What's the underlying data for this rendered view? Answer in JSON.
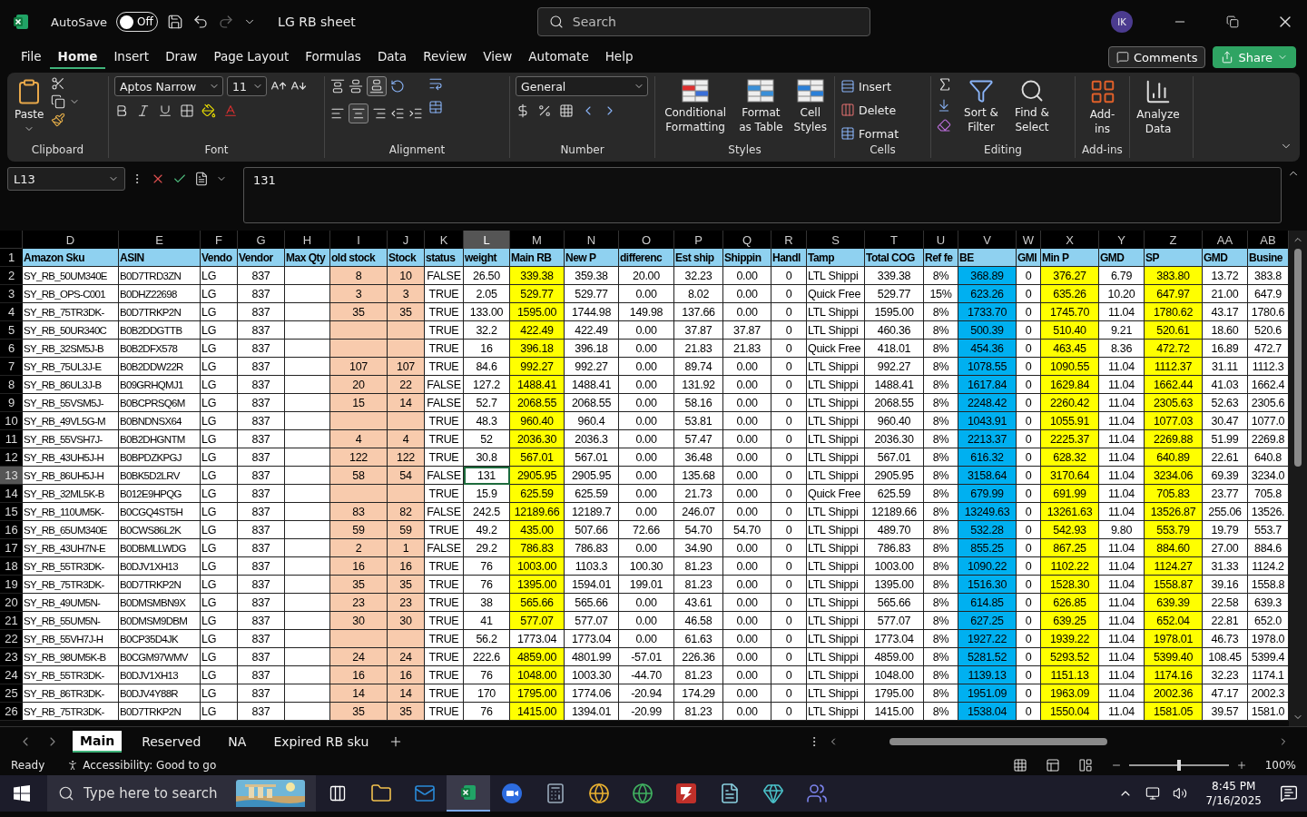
{
  "title_bar": {
    "autosave_label": "AutoSave",
    "autosave": {
      "on": false,
      "label": "Off"
    },
    "document_title": "LG RB sheet",
    "search": {
      "placeholder": "Search"
    },
    "avatar": "IK"
  },
  "menu_tabs": [
    {
      "label": "File",
      "selected": false
    },
    {
      "label": "Home",
      "selected": true
    },
    {
      "label": "Insert",
      "selected": false
    },
    {
      "label": "Draw",
      "selected": false
    },
    {
      "label": "Page Layout",
      "selected": false
    },
    {
      "label": "Formulas",
      "selected": false
    },
    {
      "label": "Data",
      "selected": false
    },
    {
      "label": "Review",
      "selected": false
    },
    {
      "label": "View",
      "selected": false
    },
    {
      "label": "Automate",
      "selected": false
    },
    {
      "label": "Help",
      "selected": false
    }
  ],
  "header_buttons": {
    "comments": "Comments",
    "share": "Share"
  },
  "ribbon": {
    "font_name": "Aptos Narrow",
    "font_size": "11",
    "number_format": "General",
    "groups": [
      {
        "label": "Clipboard",
        "buttons": [
          "Paste"
        ]
      },
      {
        "label": "Font"
      },
      {
        "label": "Alignment"
      },
      {
        "label": "Number"
      },
      {
        "label": "Styles",
        "buttons": [
          "Conditional Formatting",
          "Format as Table",
          "Cell Styles"
        ]
      },
      {
        "label": "Cells",
        "buttons": [
          "Insert",
          "Delete",
          "Format"
        ]
      },
      {
        "label": "Editing",
        "buttons": [
          "Sort & Filter",
          "Find & Select"
        ]
      },
      {
        "label": "Add-ins",
        "buttons": [
          "Add-ins"
        ]
      },
      {
        "buttons": [
          "Analyze Data"
        ]
      }
    ]
  },
  "formula_bar": {
    "name_box": "L13",
    "formula": "131"
  },
  "columns": [
    {
      "letter": "D",
      "header": "Amazon Sku",
      "selected": false
    },
    {
      "letter": "E",
      "header": "ASIN",
      "selected": false
    },
    {
      "letter": "F",
      "header": "Vendo",
      "selected": false
    },
    {
      "letter": "G",
      "header": "Vendor",
      "selected": false
    },
    {
      "letter": "H",
      "header": "Max Qty",
      "selected": false
    },
    {
      "letter": "I",
      "header": "old stock",
      "selected": false,
      "color": "#f8cbad"
    },
    {
      "letter": "J",
      "header": "Stock",
      "selected": false,
      "color": "#f8cbad"
    },
    {
      "letter": "K",
      "header": "status",
      "selected": false
    },
    {
      "letter": "L",
      "header": "weight",
      "selected": true
    },
    {
      "letter": "M",
      "header": "Main RB",
      "selected": false,
      "color": "#ffff00"
    },
    {
      "letter": "N",
      "header": "New P",
      "selected": false
    },
    {
      "letter": "O",
      "header": "differenc",
      "selected": false
    },
    {
      "letter": "P",
      "header": "Est ship",
      "selected": false
    },
    {
      "letter": "Q",
      "header": "Shippin",
      "selected": false
    },
    {
      "letter": "R",
      "header": "Handl",
      "selected": false
    },
    {
      "letter": "S",
      "header": "Tamp",
      "selected": false
    },
    {
      "letter": "T",
      "header": "Total COG",
      "selected": false
    },
    {
      "letter": "U",
      "header": "Ref fe",
      "selected": false
    },
    {
      "letter": "V",
      "header": "BE",
      "selected": false,
      "color": "#00b0f0"
    },
    {
      "letter": "W",
      "header": "GMI",
      "selected": false
    },
    {
      "letter": "X",
      "header": "Min P",
      "selected": false,
      "color": "#ffff00"
    },
    {
      "letter": "Y",
      "header": "GMD",
      "selected": false
    },
    {
      "letter": "Z",
      "header": "SP",
      "selected": false,
      "color": "#ffff00"
    },
    {
      "letter": "AA",
      "header": "GMD",
      "selected": false
    },
    {
      "letter": "AB",
      "header": "Busine",
      "selected": false
    }
  ],
  "header_row_number": "1",
  "rows": [
    {
      "number": "2",
      "selected": false,
      "highlighted": true,
      "cells": [
        "SY_RB_50UM340E",
        "B0D7TRD3ZN",
        "LG",
        "837",
        "",
        "8",
        "10",
        "FALSE",
        "26.50",
        "339.38",
        "359.38",
        "20.00",
        "32.23",
        "0.00",
        "0",
        "LTL Shippi",
        "339.38",
        "8%",
        "368.89",
        "0",
        "376.27",
        "6.79",
        "383.80",
        "13.72",
        "383.8"
      ]
    },
    {
      "number": "3",
      "selected": false,
      "highlighted": true,
      "cells": [
        "SY_RB_OPS-C001",
        "B0DHZ22698",
        "LG",
        "837",
        "",
        "3",
        "3",
        "TRUE",
        "2.05",
        "529.77",
        "529.77",
        "0.00",
        "8.02",
        "0.00",
        "0",
        "Quick Free",
        "529.77",
        "15%",
        "623.26",
        "0",
        "635.26",
        "10.20",
        "647.97",
        "21.00",
        "647.9"
      ]
    },
    {
      "number": "4",
      "selected": false,
      "highlighted": true,
      "cells": [
        "SY_RB_75TR3DK-",
        "B0D7TRKP2N",
        "LG",
        "837",
        "",
        "35",
        "35",
        "TRUE",
        "133.00",
        "1595.00",
        "1744.98",
        "149.98",
        "137.66",
        "0.00",
        "0",
        "LTL Shippi",
        "1595.00",
        "8%",
        "1733.70",
        "0",
        "1745.70",
        "11.04",
        "1780.62",
        "43.17",
        "1780.6"
      ]
    },
    {
      "number": "5",
      "selected": false,
      "highlighted": true,
      "cells": [
        "SY_RB_50UR340C",
        "B0B2DDGTTB",
        "LG",
        "837",
        "",
        "",
        "",
        "TRUE",
        "32.2",
        "422.49",
        "422.49",
        "0.00",
        "37.87",
        "37.87",
        "0",
        "LTL Shippi",
        "460.36",
        "8%",
        "500.39",
        "0",
        "510.40",
        "9.21",
        "520.61",
        "18.60",
        "520.6"
      ]
    },
    {
      "number": "6",
      "selected": false,
      "highlighted": true,
      "cells": [
        "SY_RB_32SM5J-B",
        "B0B2DFX578",
        "LG",
        "837",
        "",
        "",
        "",
        "TRUE",
        "16",
        "396.18",
        "396.18",
        "0.00",
        "21.83",
        "21.83",
        "0",
        "Quick Free",
        "418.01",
        "8%",
        "454.36",
        "0",
        "463.45",
        "8.36",
        "472.72",
        "16.89",
        "472.7"
      ]
    },
    {
      "number": "7",
      "selected": false,
      "highlighted": true,
      "cells": [
        "SY_RB_75UL3J-E",
        "B0B2DDW22R",
        "LG",
        "837",
        "",
        "107",
        "107",
        "TRUE",
        "84.6",
        "992.27",
        "992.27",
        "0.00",
        "89.74",
        "0.00",
        "0",
        "LTL Shippi",
        "992.27",
        "8%",
        "1078.55",
        "0",
        "1090.55",
        "11.04",
        "1112.37",
        "31.11",
        "1112.3"
      ]
    },
    {
      "number": "8",
      "selected": false,
      "highlighted": true,
      "cells": [
        "SY_RB_86UL3J-B",
        "B09GRHQMJ1",
        "LG",
        "837",
        "",
        "20",
        "22",
        "FALSE",
        "127.2",
        "1488.41",
        "1488.41",
        "0.00",
        "131.92",
        "0.00",
        "0",
        "LTL Shippi",
        "1488.41",
        "8%",
        "1617.84",
        "0",
        "1629.84",
        "11.04",
        "1662.44",
        "41.03",
        "1662.4"
      ]
    },
    {
      "number": "9",
      "selected": false,
      "highlighted": true,
      "cells": [
        "SY_RB_55VSM5J-",
        "B0BCPRSQ6M",
        "LG",
        "837",
        "",
        "15",
        "14",
        "FALSE",
        "52.7",
        "2068.55",
        "2068.55",
        "0.00",
        "58.16",
        "0.00",
        "0",
        "LTL Shippi",
        "2068.55",
        "8%",
        "2248.42",
        "0",
        "2260.42",
        "11.04",
        "2305.63",
        "52.63",
        "2305.6"
      ]
    },
    {
      "number": "10",
      "selected": false,
      "highlighted": true,
      "cells": [
        "SY_RB_49VL5G-M",
        "B0BNDNSX64",
        "LG",
        "837",
        "",
        "",
        "",
        "TRUE",
        "48.3",
        "960.40",
        "960.4",
        "0.00",
        "53.81",
        "0.00",
        "0",
        "LTL Shippi",
        "960.40",
        "8%",
        "1043.91",
        "0",
        "1055.91",
        "11.04",
        "1077.03",
        "30.47",
        "1077.0"
      ]
    },
    {
      "number": "11",
      "selected": false,
      "highlighted": true,
      "cells": [
        "SY_RB_55VSH7J-",
        "B0B2DHGNTM",
        "LG",
        "837",
        "",
        "4",
        "4",
        "TRUE",
        "52",
        "2036.30",
        "2036.3",
        "0.00",
        "57.47",
        "0.00",
        "0",
        "LTL Shippi",
        "2036.30",
        "8%",
        "2213.37",
        "0",
        "2225.37",
        "11.04",
        "2269.88",
        "51.99",
        "2269.8"
      ]
    },
    {
      "number": "12",
      "selected": false,
      "highlighted": true,
      "cells": [
        "SY_RB_43UH5J-H",
        "B0BPDZKPGJ",
        "LG",
        "837",
        "",
        "122",
        "122",
        "TRUE",
        "30.8",
        "567.01",
        "567.01",
        "0.00",
        "36.48",
        "0.00",
        "0",
        "LTL Shippi",
        "567.01",
        "8%",
        "616.32",
        "0",
        "628.32",
        "11.04",
        "640.89",
        "22.61",
        "640.8"
      ]
    },
    {
      "number": "13",
      "selected": true,
      "highlighted": true,
      "cells": [
        "SY_RB_86UH5J-H",
        "B0BK5D2LRV",
        "LG",
        "837",
        "",
        "58",
        "54",
        "FALSE",
        "131",
        "2905.95",
        "2905.95",
        "0.00",
        "135.68",
        "0.00",
        "0",
        "LTL Shippi",
        "2905.95",
        "8%",
        "3158.64",
        "0",
        "3170.64",
        "11.04",
        "3234.06",
        "69.39",
        "3234.0"
      ]
    },
    {
      "number": "14",
      "selected": false,
      "highlighted": true,
      "cells": [
        "SY_RB_32ML5K-B",
        "B012E9HPQG",
        "LG",
        "837",
        "",
        "",
        "",
        "TRUE",
        "15.9",
        "625.59",
        "625.59",
        "0.00",
        "21.73",
        "0.00",
        "0",
        "Quick Free",
        "625.59",
        "8%",
        "679.99",
        "0",
        "691.99",
        "11.04",
        "705.83",
        "23.77",
        "705.8"
      ]
    },
    {
      "number": "15",
      "selected": false,
      "highlighted": true,
      "cells": [
        "SY_RB_110UM5K-",
        "B0CGQ4ST5H",
        "LG",
        "837",
        "",
        "83",
        "82",
        "FALSE",
        "242.5",
        "12189.66",
        "12189.7",
        "0.00",
        "246.07",
        "0.00",
        "0",
        "LTL Shippi",
        "12189.66",
        "8%",
        "13249.63",
        "0",
        "13261.63",
        "11.04",
        "13526.87",
        "255.06",
        "13526."
      ]
    },
    {
      "number": "16",
      "selected": false,
      "highlighted": true,
      "cells": [
        "SY_RB_65UM340E",
        "B0CWS86L2K",
        "LG",
        "837",
        "",
        "59",
        "59",
        "TRUE",
        "49.2",
        "435.00",
        "507.66",
        "72.66",
        "54.70",
        "54.70",
        "0",
        "LTL Shippi",
        "489.70",
        "8%",
        "532.28",
        "0",
        "542.93",
        "9.80",
        "553.79",
        "19.79",
        "553.7"
      ]
    },
    {
      "number": "17",
      "selected": false,
      "highlighted": true,
      "cells": [
        "SY_RB_43UH7N-E",
        "B0DBMLLWDG",
        "LG",
        "837",
        "",
        "2",
        "1",
        "FALSE",
        "29.2",
        "786.83",
        "786.83",
        "0.00",
        "34.90",
        "0.00",
        "0",
        "LTL Shippi",
        "786.83",
        "8%",
        "855.25",
        "0",
        "867.25",
        "11.04",
        "884.60",
        "27.00",
        "884.6"
      ]
    },
    {
      "number": "18",
      "selected": false,
      "highlighted": true,
      "cells": [
        "SY_RB_55TR3DK-",
        "B0DJV1XH13",
        "LG",
        "837",
        "",
        "16",
        "16",
        "TRUE",
        "76",
        "1003.00",
        "1103.3",
        "100.30",
        "81.23",
        "0.00",
        "0",
        "LTL Shippi",
        "1003.00",
        "8%",
        "1090.22",
        "0",
        "1102.22",
        "11.04",
        "1124.27",
        "31.33",
        "1124.2"
      ]
    },
    {
      "number": "19",
      "selected": false,
      "highlighted": true,
      "cells": [
        "SY_RB_75TR3DK-",
        "B0D7TRKP2N",
        "LG",
        "837",
        "",
        "35",
        "35",
        "TRUE",
        "76",
        "1395.00",
        "1594.01",
        "199.01",
        "81.23",
        "0.00",
        "0",
        "LTL Shippi",
        "1395.00",
        "8%",
        "1516.30",
        "0",
        "1528.30",
        "11.04",
        "1558.87",
        "39.16",
        "1558.8"
      ]
    },
    {
      "number": "20",
      "selected": false,
      "highlighted": true,
      "cells": [
        "SY_RB_49UM5N-",
        "B0DMSMBN9X",
        "LG",
        "837",
        "",
        "23",
        "23",
        "TRUE",
        "38",
        "565.66",
        "565.66",
        "0.00",
        "43.61",
        "0.00",
        "0",
        "LTL Shippi",
        "565.66",
        "8%",
        "614.85",
        "0",
        "626.85",
        "11.04",
        "639.39",
        "22.58",
        "639.3"
      ]
    },
    {
      "number": "21",
      "selected": false,
      "highlighted": true,
      "cells": [
        "SY_RB_55UM5N-",
        "B0DMSM9DBM",
        "LG",
        "837",
        "",
        "30",
        "30",
        "TRUE",
        "41",
        "577.07",
        "577.07",
        "0.00",
        "46.58",
        "0.00",
        "0",
        "LTL Shippi",
        "577.07",
        "8%",
        "627.25",
        "0",
        "639.25",
        "11.04",
        "652.04",
        "22.81",
        "652.0"
      ]
    },
    {
      "number": "22",
      "selected": false,
      "highlighted": false,
      "cells": [
        "SY_RB_55VH7J-H",
        "B0CP35D4JK",
        "LG",
        "837",
        "",
        "",
        "",
        "TRUE",
        "56.2",
        "1773.04",
        "1773.04",
        "0.00",
        "61.63",
        "0.00",
        "0",
        "LTL Shippi",
        "1773.04",
        "8%",
        "1927.22",
        "0",
        "1939.22",
        "11.04",
        "1978.01",
        "46.73",
        "1978.0"
      ]
    },
    {
      "number": "23",
      "selected": false,
      "highlighted": true,
      "cells": [
        "SY_RB_98UM5K-B",
        "B0CGM97WMV",
        "LG",
        "837",
        "",
        "24",
        "24",
        "TRUE",
        "222.6",
        "4859.00",
        "4801.99",
        "-57.01",
        "226.36",
        "0.00",
        "0",
        "LTL Shippi",
        "4859.00",
        "8%",
        "5281.52",
        "0",
        "5293.52",
        "11.04",
        "5399.40",
        "108.45",
        "5399.4"
      ]
    },
    {
      "number": "24",
      "selected": false,
      "highlighted": true,
      "cells": [
        "SY_RB_55TR3DK-",
        "B0DJV1XH13",
        "LG",
        "837",
        "",
        "16",
        "16",
        "TRUE",
        "76",
        "1048.00",
        "1003.30",
        "-44.70",
        "81.23",
        "0.00",
        "0",
        "LTL Shippi",
        "1048.00",
        "8%",
        "1139.13",
        "0",
        "1151.13",
        "11.04",
        "1174.16",
        "32.23",
        "1174.1"
      ]
    },
    {
      "number": "25",
      "selected": false,
      "highlighted": true,
      "cells": [
        "SY_RB_86TR3DK-",
        "B0DJV4Y88R",
        "LG",
        "837",
        "",
        "14",
        "14",
        "TRUE",
        "170",
        "1795.00",
        "1774.06",
        "-20.94",
        "174.29",
        "0.00",
        "0",
        "LTL Shippi",
        "1795.00",
        "8%",
        "1951.09",
        "0",
        "1963.09",
        "11.04",
        "2002.36",
        "47.17",
        "2002.3"
      ]
    },
    {
      "number": "26",
      "selected": false,
      "highlighted": true,
      "cells": [
        "SY_RB_75TR3DK-",
        "B0D7TRKP2N",
        "LG",
        "837",
        "",
        "35",
        "35",
        "TRUE",
        "76",
        "1415.00",
        "1394.01",
        "-20.99",
        "81.23",
        "0.00",
        "0",
        "LTL Shippi",
        "1415.00",
        "8%",
        "1538.04",
        "0",
        "1550.04",
        "11.04",
        "1581.05",
        "39.57",
        "1581.0"
      ]
    }
  ],
  "sheet_tabs": [
    {
      "label": "Main",
      "selected": true
    },
    {
      "label": "Reserved",
      "selected": false
    },
    {
      "label": "NA",
      "selected": false
    },
    {
      "label": "Expired RB sku",
      "selected": false
    }
  ],
  "status_bar": {
    "mode": "Ready",
    "accessibility": "Accessibility: Good to go",
    "zoom_slider": {
      "level": 0.5
    },
    "zoom": "100%"
  },
  "taskbar": {
    "search_placeholder": "Type here to search",
    "time": "8:45 PM",
    "date": "7/16/2025"
  }
}
